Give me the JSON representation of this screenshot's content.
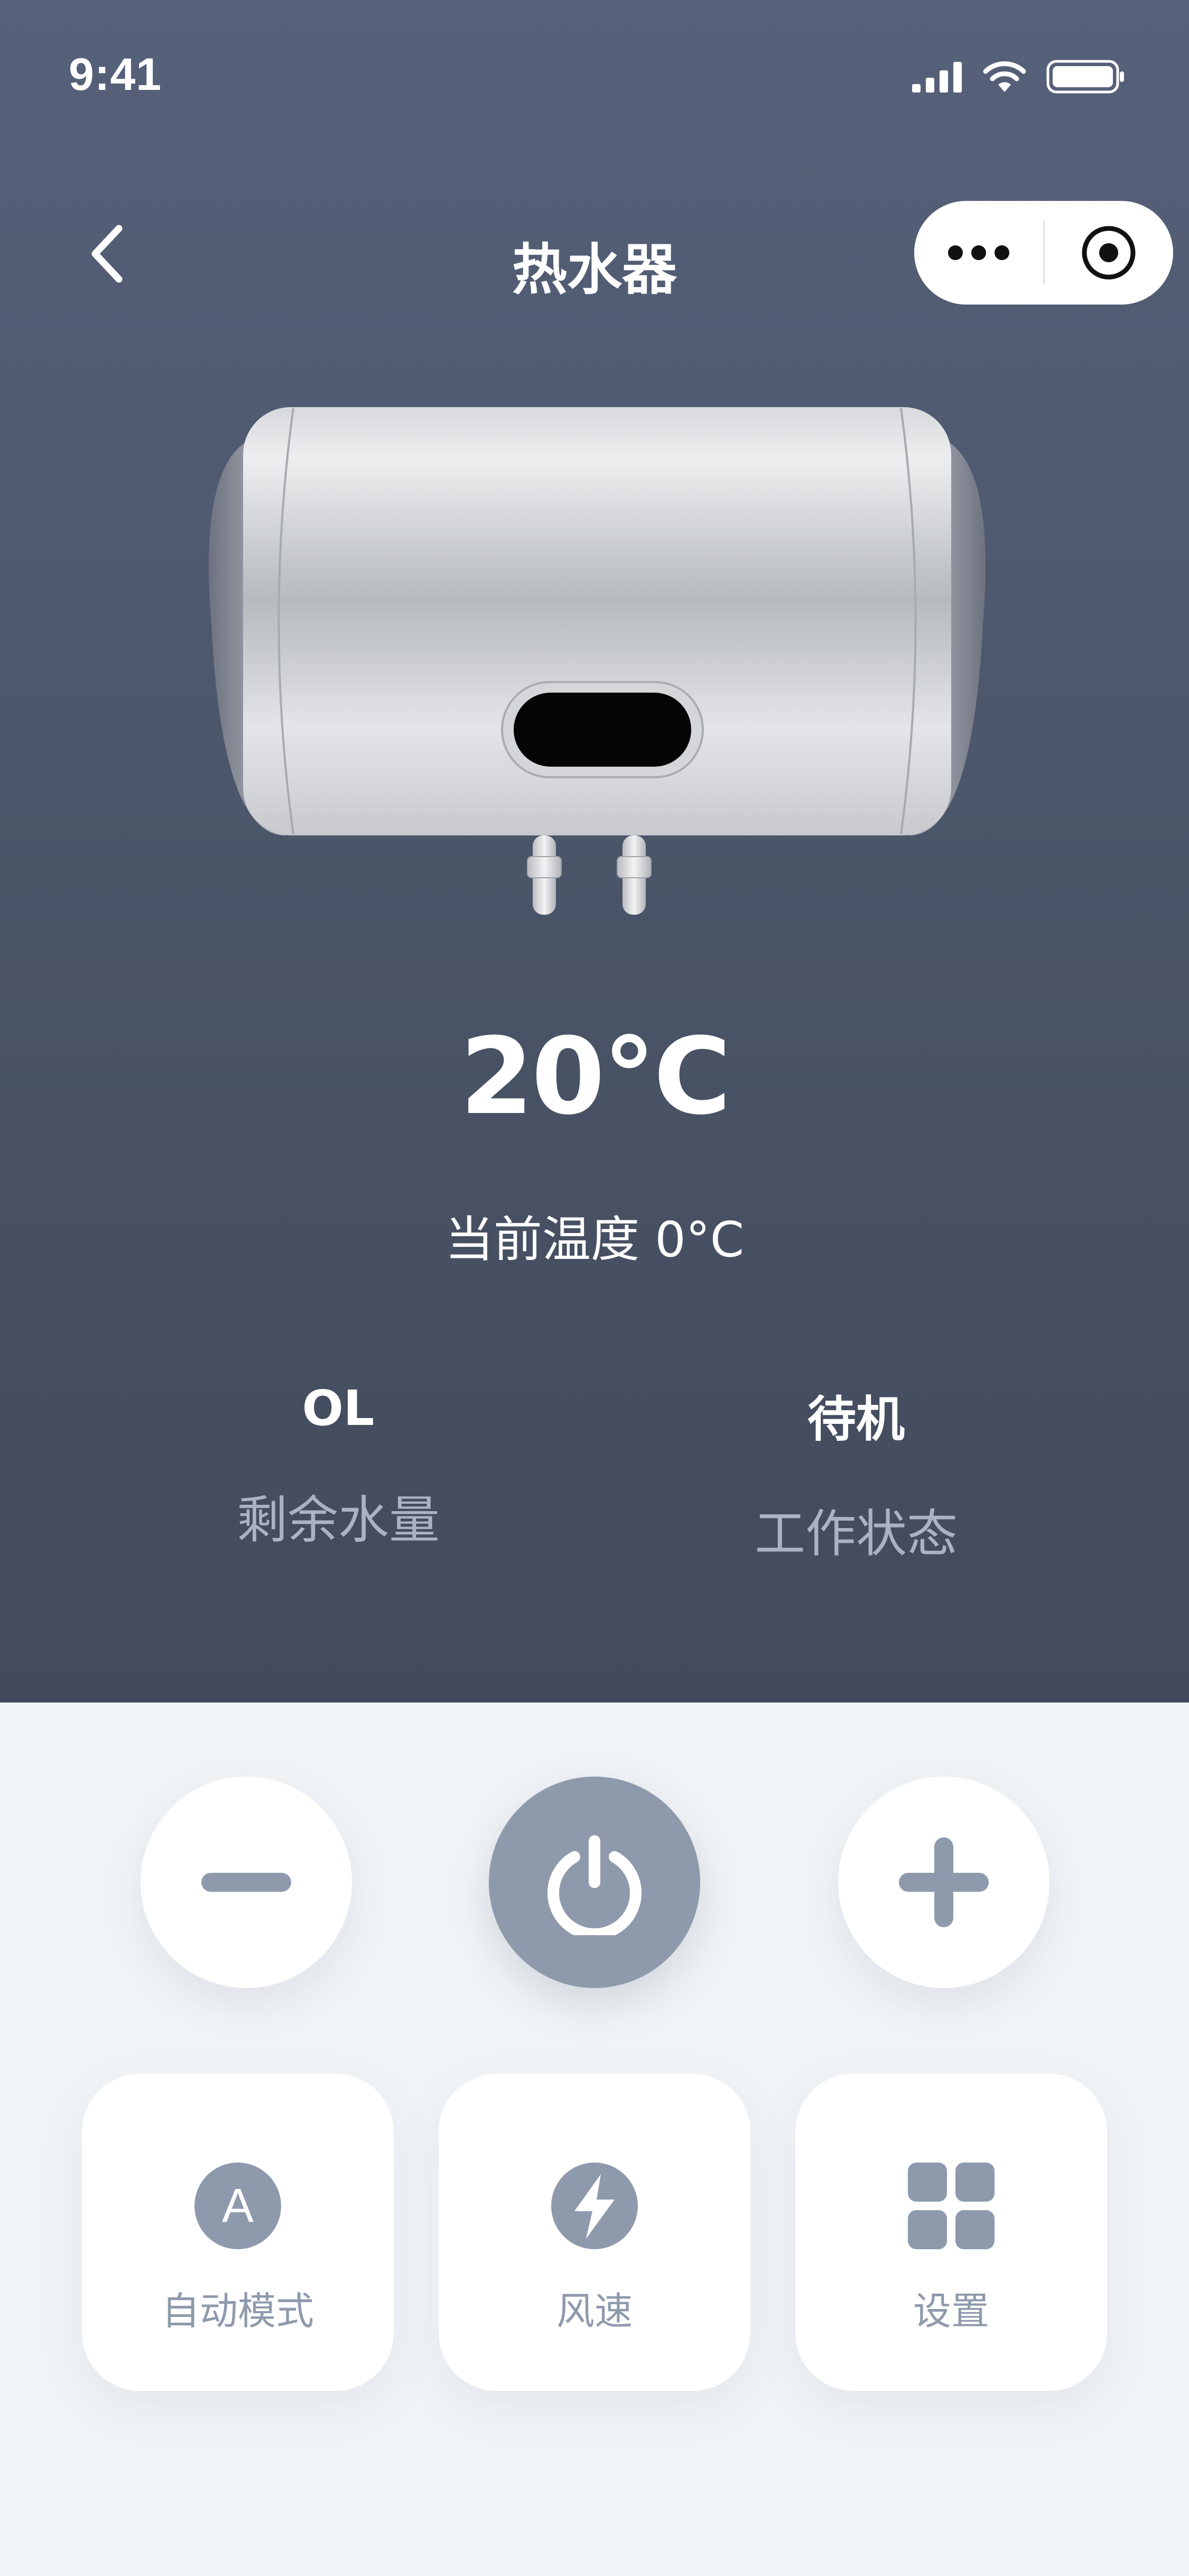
{
  "status_bar": {
    "time": "9:41",
    "icons": [
      "signal-icon",
      "wifi-icon",
      "battery-icon"
    ]
  },
  "nav": {
    "title": "热水器",
    "back_icon": "chevron-left-icon",
    "capsule_icons": [
      "more-dots-icon",
      "target-icon"
    ]
  },
  "device": {
    "image": "water-heater-image",
    "set_temperature": "20°C",
    "current_temperature": "当前温度 0°C"
  },
  "stats": [
    {
      "value": "OL",
      "label": "剩余水量"
    },
    {
      "value": "待机",
      "label": "工作状态"
    }
  ],
  "controls": {
    "minus_icon": "minus-icon",
    "power_icon": "power-icon",
    "plus_icon": "plus-icon"
  },
  "modes": [
    {
      "label": "自动模式",
      "icon": "auto-a-icon",
      "icon_letter": "A"
    },
    {
      "label": "风速",
      "icon": "lightning-icon"
    },
    {
      "label": "设置",
      "icon": "grid-icon"
    }
  ],
  "colors": {
    "hero_top": "#56617a",
    "hero_bottom": "#424b5b",
    "accent_gray": "#8e9aac",
    "label_gray": "#aab3c2",
    "panel_bg": "#f1f4f7"
  }
}
